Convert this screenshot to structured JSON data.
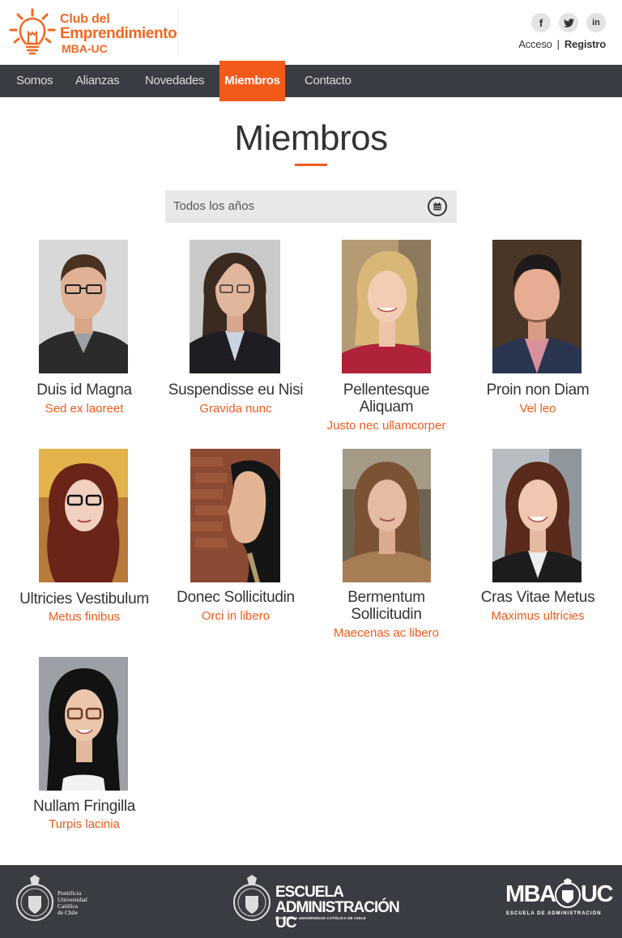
{
  "header": {
    "logo": {
      "line1": "Club del",
      "line2": "Emprendimiento",
      "line3": "MBA-UC"
    },
    "social": [
      {
        "icon": "facebook-icon",
        "glyph": "f"
      },
      {
        "icon": "twitter-icon",
        "glyph": "t"
      },
      {
        "icon": "linkedin-icon",
        "glyph": "in"
      }
    ],
    "login": "Acceso",
    "separator": "|",
    "register": "Registro"
  },
  "nav": {
    "items": [
      {
        "label": "Somos"
      },
      {
        "label": "Alianzas"
      },
      {
        "label": "Novedades"
      },
      {
        "label": "Miembros",
        "active": true
      },
      {
        "label": "Contacto"
      }
    ]
  },
  "page": {
    "title": "Miembros"
  },
  "filter": {
    "value": "Todos los años",
    "icon": "calendar-icon"
  },
  "members": [
    {
      "name": "Duis id Magna",
      "role": "Sed ex laoreet"
    },
    {
      "name": "Suspendisse eu Nisi",
      "role": "Gravida nunc"
    },
    {
      "name": "Pellentesque Aliquam",
      "name_l1": "Pellentesque",
      "name_l2": "Aliquam",
      "role": "Justo nec ullamcorper"
    },
    {
      "name": "Proin non Diam",
      "role": "Vel leo"
    },
    {
      "name": "Ultricies Vestibulum",
      "role": "Metus finibus"
    },
    {
      "name": "Donec Sollicitudin",
      "role": "Orci in libero"
    },
    {
      "name": "Bermentum Sollicitudin",
      "name_l1": "Bermentum",
      "name_l2": "Sollicitudin",
      "role": "Maecenas ac libero"
    },
    {
      "name": "Cras Vitae Metus",
      "role": "Maximus ultricies"
    },
    {
      "name": "Nullam Fringilla",
      "role": "Turpis lacinia"
    }
  ],
  "footer": {
    "puc": {
      "l1": "Pontificia",
      "l2": "Universidad",
      "l3": "Católica",
      "l4": "de Chile"
    },
    "escuela": {
      "l1": "ESCUELA",
      "l2": "ADMINISTRACIÓN UC",
      "l3": "PONTIFICIA UNIVERSIDAD CATÓLICA DE CHILE"
    },
    "mba": {
      "l1a": "MBA",
      "l1b": "UC",
      "l2": "ESCUELA DE ADMINISTRACIÓN"
    }
  },
  "colors": {
    "accent": "#f25a1a",
    "nav_bg": "#3a3c43",
    "footer_bg": "#3a3c43"
  }
}
